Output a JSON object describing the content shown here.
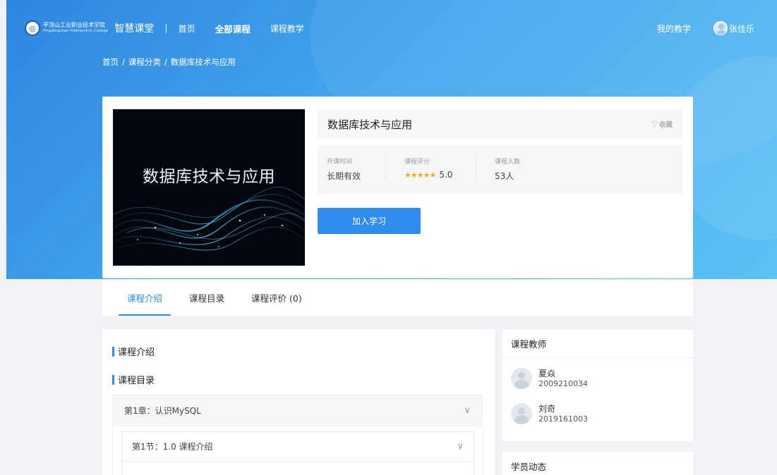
{
  "header": {
    "logo_cn": "平顶山工业职业技术学院",
    "logo_en": "Pingdingshan Polytechnic College",
    "brand": "智慧课堂",
    "separator": "|",
    "nav": [
      "首页",
      "全部课程",
      "课程教学"
    ],
    "active_nav": "全部课程",
    "my_teaching": "我的教学",
    "username": "张佳乐"
  },
  "breadcrumb": [
    "首页",
    "课程分类",
    "数据库技术与应用"
  ],
  "course": {
    "cover_title": "数据库技术与应用",
    "title": "数据库技术与应用",
    "favorite": "收藏",
    "open_time_label": "开课时间",
    "open_time_value": "长期有效",
    "rating_label": "课程评分",
    "rating_stars": "★★★★★",
    "rating_value": "5.0",
    "students_label": "课程人数",
    "students_value": "53人",
    "join_button": "加入学习"
  },
  "tabs": [
    "课程介绍",
    "课程目录",
    "课程评价 (0)"
  ],
  "intro": {
    "intro_heading": "课程介绍",
    "catalog_heading": "课程目录",
    "chapter": "第1章：认识MySQL",
    "lesson": "第1节：1.0 课程介绍"
  },
  "teachers": {
    "heading": "课程教师",
    "list": [
      {
        "name": "夏焱",
        "id": "2009210034"
      },
      {
        "name": "刘奇",
        "id": "2019161003"
      }
    ]
  },
  "students": {
    "heading": "学员动态"
  },
  "colors": {
    "primary": "#2f8dee",
    "hero_start": "#2f86e0",
    "hero_end": "#5ec1f5",
    "star": "#f3a821"
  }
}
